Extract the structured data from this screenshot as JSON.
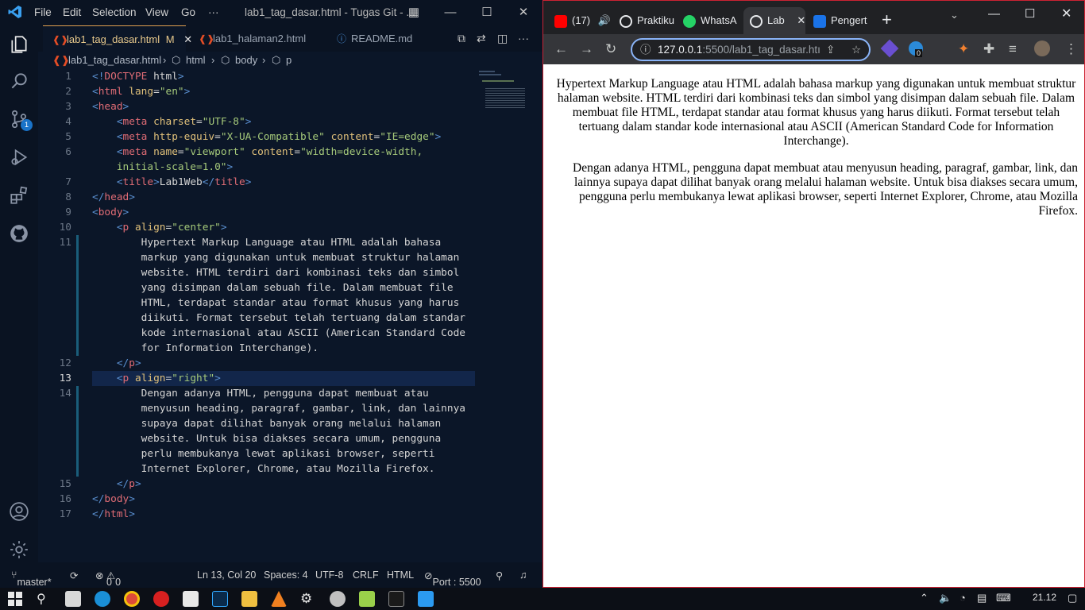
{
  "vscode": {
    "menu": [
      "File",
      "Edit",
      "Selection",
      "View",
      "Go",
      "···"
    ],
    "window_title": "lab1_tag_dasar.html - Tugas Git - ...",
    "tabs": [
      {
        "label": "lab1_tag_dasar.html",
        "suffix": "M",
        "active": true
      },
      {
        "label": "lab1_halaman2.html",
        "active": false
      },
      {
        "label": "README.md",
        "active": false
      }
    ],
    "source_control_badge": "1",
    "breadcrumb": [
      "lab1_tag_dasar.html",
      "html",
      "body",
      "p"
    ],
    "lines": [
      {
        "n": "1",
        "html": "<span class='t'>&lt;!</span><span class='tn'>DOCTYPE</span> <span class='txt'>html</span><span class='t'>&gt;</span>"
      },
      {
        "n": "2",
        "html": "<span class='t'>&lt;</span><span class='tn'>html</span> <span class='at'>lang</span><span class='txt'>=</span><span class='av'>\"en\"</span><span class='t'>&gt;</span>"
      },
      {
        "n": "3",
        "html": "<span class='t'>&lt;</span><span class='tn'>head</span><span class='t'>&gt;</span>"
      },
      {
        "n": "4",
        "html": "    <span class='t'>&lt;</span><span class='tn'>meta</span> <span class='at'>charset</span><span class='txt'>=</span><span class='av'>\"UTF-8\"</span><span class='t'>&gt;</span>"
      },
      {
        "n": "5",
        "html": "    <span class='t'>&lt;</span><span class='tn'>meta</span> <span class='at'>http-equiv</span><span class='txt'>=</span><span class='av'>\"X-UA-Compatible\"</span> <span class='at'>content</span><span class='txt'>=</span><span class='av'>\"IE=edge\"</span><span class='t'>&gt;</span>"
      },
      {
        "n": "6",
        "html": "    <span class='t'>&lt;</span><span class='tn'>meta</span> <span class='at'>name</span><span class='txt'>=</span><span class='av'>\"viewport\"</span> <span class='at'>content</span><span class='txt'>=</span><span class='av'>\"width=device-width,</span>"
      },
      {
        "n": "",
        "html": "    <span class='av'>initial-scale=1.0\"</span><span class='t'>&gt;</span>"
      },
      {
        "n": "7",
        "html": "    <span class='t'>&lt;</span><span class='tn'>title</span><span class='t'>&gt;</span><span class='txt'>Lab1Web</span><span class='t'>&lt;/</span><span class='tn'>title</span><span class='t'>&gt;</span>"
      },
      {
        "n": "8",
        "html": "<span class='t'>&lt;/</span><span class='tn'>head</span><span class='t'>&gt;</span>"
      },
      {
        "n": "9",
        "html": "<span class='t'>&lt;</span><span class='tn'>body</span><span class='t'>&gt;</span>"
      },
      {
        "n": "10",
        "html": "    <span class='t'>&lt;</span><span class='tn'>p</span> <span class='at'>align</span><span class='txt'>=</span><span class='av'>\"center\"</span><span class='t'>&gt;</span>"
      },
      {
        "n": "11",
        "html": "        <span class='txt'>Hypertext Markup Language atau HTML adalah bahasa</span>"
      },
      {
        "n": "",
        "html": "        <span class='txt'>markup yang digunakan untuk membuat struktur halaman</span>"
      },
      {
        "n": "",
        "html": "        <span class='txt'>website. HTML terdiri dari kombinasi teks dan simbol</span>"
      },
      {
        "n": "",
        "html": "        <span class='txt'>yang disimpan dalam sebuah file. Dalam membuat file</span>"
      },
      {
        "n": "",
        "html": "        <span class='txt'>HTML, terdapat standar atau format khusus yang harus</span>"
      },
      {
        "n": "",
        "html": "        <span class='txt'>diikuti. Format tersebut telah tertuang dalam standar</span>"
      },
      {
        "n": "",
        "html": "        <span class='txt'>kode internasional atau ASCII (American Standard Code</span>"
      },
      {
        "n": "",
        "html": "        <span class='txt'>for Information Interchange).</span>"
      },
      {
        "n": "12",
        "html": "    <span class='t'>&lt;/</span><span class='tn'>p</span><span class='t'>&gt;</span>"
      },
      {
        "n": "13",
        "html": "    <span class='t'>&lt;</span><span class='tn'>p</span> <span class='at'>align</span><span class='txt'>=</span><span class='av'>\"right\"</span><span class='t'>&gt;</span>"
      },
      {
        "n": "14",
        "html": "        <span class='txt'>Dengan adanya HTML, pengguna dapat membuat atau</span>"
      },
      {
        "n": "",
        "html": "        <span class='txt'>menyusun heading, paragraf, gambar, link, dan lainnya</span>"
      },
      {
        "n": "",
        "html": "        <span class='txt'>supaya dapat dilihat banyak orang melalui halaman</span>"
      },
      {
        "n": "",
        "html": "        <span class='txt'>website. Untuk bisa diakses secara umum, pengguna</span>"
      },
      {
        "n": "",
        "html": "        <span class='txt'>perlu membukanya lewat aplikasi browser, seperti</span>"
      },
      {
        "n": "",
        "html": "        <span class='txt'>Internet Explorer, Chrome, atau Mozilla Firefox.</span>"
      },
      {
        "n": "15",
        "html": "    <span class='t'>&lt;/</span><span class='tn'>p</span><span class='t'>&gt;</span>"
      },
      {
        "n": "16",
        "html": "<span class='t'>&lt;/</span><span class='tn'>body</span><span class='t'>&gt;</span>"
      },
      {
        "n": "17",
        "html": "<span class='t'>&lt;/</span><span class='tn'>html</span><span class='t'>&gt;</span>"
      }
    ],
    "status": {
      "branch": "master*",
      "errors": "0",
      "warnings": "0",
      "position": "Ln 13, Col 20",
      "spaces": "Spaces: 4",
      "encoding": "UTF-8",
      "eol": "CRLF",
      "language": "HTML",
      "port": "Port : 5500"
    }
  },
  "chrome": {
    "tabs": [
      {
        "label": "(17)",
        "icon": "youtube-icon",
        "color": "#ff0000"
      },
      {
        "label": "Praktiku",
        "icon": "globe-icon",
        "color": "#e8eaed"
      },
      {
        "label": "WhatsA",
        "icon": "whatsapp-icon",
        "color": "#25d366"
      },
      {
        "label": "Lab",
        "icon": "globe-icon",
        "color": "#e8eaed",
        "active": true
      },
      {
        "label": "Pengert",
        "icon": "chart-icon",
        "color": "#1a73e8"
      }
    ],
    "new_tab": "+",
    "url_host": "127.0.0.1",
    "url_rest": ":5500/lab1_tag_dasar.htı",
    "ext_badge": "0",
    "page": {
      "p1": "Hypertext Markup Language atau HTML adalah bahasa markup yang digunakan untuk membuat struktur halaman website. HTML terdiri dari kombinasi teks dan simbol yang disimpan dalam sebuah file. Dalam membuat file HTML, terdapat standar atau format khusus yang harus diikuti. Format tersebut telah tertuang dalam standar kode internasional atau ASCII (American Standard Code for Information Interchange).",
      "p2": "Dengan adanya HTML, pengguna dapat membuat atau menyusun heading, paragraf, gambar, link, dan lainnya supaya dapat dilihat banyak orang melalui halaman website. Untuk bisa diakses secara umum, pengguna perlu membukanya lewat aplikasi browser, seperti Internet Explorer, Chrome, atau Mozilla Firefox."
    }
  },
  "taskbar": {
    "clock": "21.12"
  }
}
